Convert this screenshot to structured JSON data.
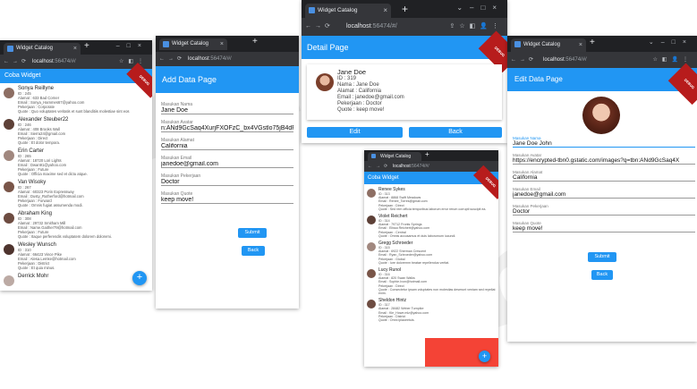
{
  "browser": {
    "tab_title": "Widget Catalog",
    "url_host": "localhost",
    "url_port": ":56474/#/"
  },
  "debug_label": "DEBUG",
  "list_window": {
    "title": "Coba Widget",
    "fab": "+",
    "items": [
      {
        "name": "Sonya Reillyne",
        "id": "ID : 245",
        "alamat": "Alamat : 633 Bad Corner",
        "email": "Email : Sonya_Hammes67@yahoo.com",
        "pekerjaan": "Pekerjaan : Corporate",
        "quote": "Quote : Quo voluptates veritatis et sunt blanditiis molestiae sint eos"
      },
      {
        "name": "Alexander Steuber22",
        "id": "ID : 246",
        "alamat": "Alamat : 408 Brooks Wall",
        "email": "Email : Sierra24@gmail.com",
        "pekerjaan": "Pekerjaan : Direct",
        "quote": "Quote : Et dolor tempora."
      },
      {
        "name": "Erin Carter",
        "id": "ID : 265",
        "alamat": "Alamat : 18720 Lori Lights",
        "email": "Email : Dwan91@yahoo.com",
        "pekerjaan": "Pekerjaan : Future",
        "quote": "Quote : Officia maxime sed et dictu atque."
      },
      {
        "name": "Van Wisoky",
        "id": "ID : 267",
        "alamat": "Alamat : 60323 Porin Expressway",
        "email": "Email : Dusty_Rutherford@hotmail.com",
        "pekerjaan": "Pekerjaan : Forward",
        "quote": "Quote : Omnis fugiat assumenda modi."
      },
      {
        "name": "Abraham King",
        "id": "ID : 308",
        "alamat": "Alamat : 29732 Smitham Mill",
        "email": "Email : Name.Gaither79@hotmail.com",
        "pekerjaan": "Pekerjaan : Future",
        "quote": "Quote : Itaque perferendis voluptatem dolorem doloremi."
      },
      {
        "name": "Wesley Wunsch",
        "id": "ID : 310",
        "alamat": "Alamat : 66423 Vince Pike",
        "email": "Email : Alesa.Lemke@hotmail.com",
        "pekerjaan": "Pekerjaan : District",
        "quote": "Quote : Et quia minus."
      },
      {
        "name": "Derrick Mohr",
        "id": "",
        "alamat": "",
        "email": "",
        "pekerjaan": "",
        "quote": ""
      }
    ]
  },
  "add_window": {
    "title": "Add Data Page",
    "fields": [
      {
        "label": "Masukan Nama",
        "value": "Jane Doe"
      },
      {
        "label": "Masukan Avatar",
        "value": "n:ANd9GcSaq4XurjFXOFzC_bx4VGstlo75jB4dFu"
      },
      {
        "label": "Masukan Alamat",
        "value": "California"
      },
      {
        "label": "Masukan Email",
        "value": "janedoe@gmail.com"
      },
      {
        "label": "Masukan Pekerjaan",
        "value": "Doctor"
      },
      {
        "label": "Masukan Quote",
        "value": "keep move!"
      }
    ],
    "submit": "Submit",
    "back": "Back"
  },
  "detail_window": {
    "title": "Detail Page",
    "name": "Jane Doe",
    "id": "ID : 319",
    "nama": "Nama : Jane Doe",
    "alamat": "Alamat : California",
    "email": "Email : janedoe@gmail.com",
    "pekerjaan": "Pekerjaan : Doctor",
    "quote": "Quote : keep move!",
    "edit": "Edit",
    "back": "Back"
  },
  "list2_window": {
    "title": "Coba Widget",
    "fab": "+",
    "items": [
      {
        "name": "Renee Sykes",
        "id": "ID : 313",
        "alamat": "Alamat : 8868 Swift Meadows",
        "email": "Email : Renee_Torres@gmail.com",
        "pekerjaan": "Pekerjaan : Direct",
        "quote": "Quote : Sed rem officia temporibus laborum error rerum corrupti suscipit ea."
      },
      {
        "name": "Violet Reichert",
        "id": "ID : 314",
        "alamat": "Alamat : 79712 Fronts Springs",
        "email": "Email : Elissa Reichert@yahoo.com",
        "pekerjaan": "Pekerjaan : Central",
        "quote": "Quote : Omnis accusamus et duis laborumum iucundi."
      },
      {
        "name": "Gregg Schroeder",
        "id": "ID : 315",
        "alamat": "Alamat : 6922 Sherman Crescent",
        "email": "Email : Ryan_Schroeder@yahoo.com",
        "pekerjaan": "Pekerjaan : Global",
        "quote": "Quote : Iure doloremm beatae repellendus veritat."
      },
      {
        "name": "Lucy Runol",
        "id": "ID : 316",
        "alamat": "Alamat : 820 Swan Walks",
        "email": "Email : Sophie.Ivon@hotmail.com",
        "pekerjaan": "Pekerjaan : Direct",
        "quote": "Quote : Consectetur ipsam voluptates non molestias deserunt veniam sed repellat enim."
      },
      {
        "name": "Sheldon Hintz",
        "id": "ID : 317",
        "alamat": "Alamat : 28482 Weber Turnpike",
        "email": "Email : Kie_Howe.mlz@yahoo.com",
        "pekerjaan": "Pekerjaan : District",
        "quote": "Quote : Omni iplaoeetuis."
      }
    ]
  },
  "edit_window": {
    "title": "Edit Data Page",
    "fields": [
      {
        "label": "Masukan Nama",
        "value": "Jane Doe John"
      },
      {
        "label": "Masukan Avatar",
        "value": "https://encrypted-tbn0.gstatic.com/images?q=tbn:ANd9GcSaq4X"
      },
      {
        "label": "Masukan Alamat",
        "value": "California"
      },
      {
        "label": "Masukan Email",
        "value": "janedoe@gmail.com"
      },
      {
        "label": "Masukan Pekerjaan",
        "value": "Doctor"
      },
      {
        "label": "Masukan Quote",
        "value": "keep move!"
      }
    ],
    "submit": "Submit",
    "back": "Back"
  }
}
